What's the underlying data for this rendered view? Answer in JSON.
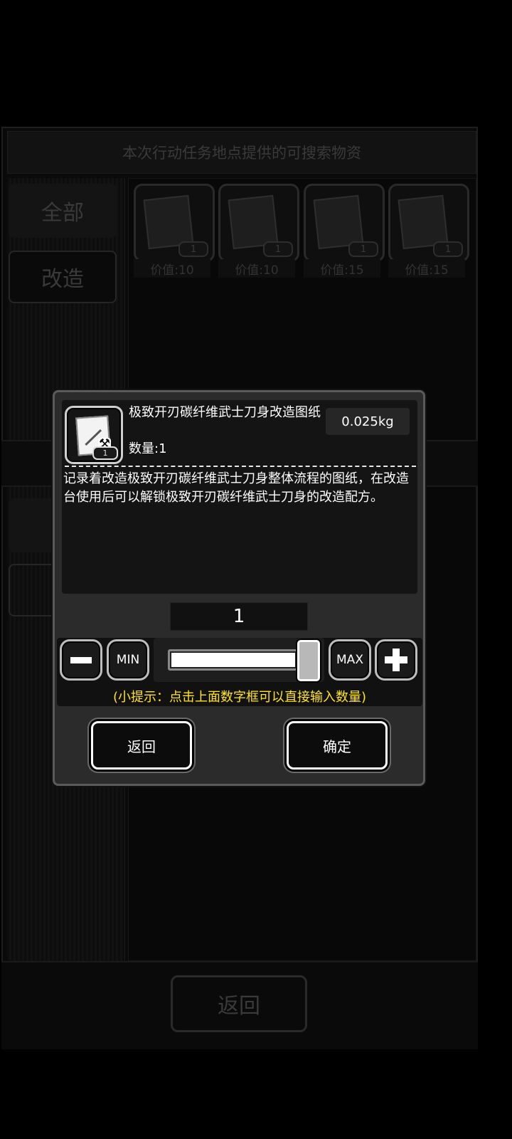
{
  "background": {
    "title": "本次行动任务地点提供的可搜索物资",
    "tabs": [
      {
        "label": "全部"
      },
      {
        "label": "改造"
      }
    ],
    "items": [
      {
        "value_label": "价值:10",
        "count": "1"
      },
      {
        "value_label": "价值:10",
        "count": "1"
      },
      {
        "value_label": "价值:15",
        "count": "1"
      },
      {
        "value_label": "价值:15",
        "count": "1"
      }
    ],
    "back_label": "返回"
  },
  "dialog": {
    "item_name": "极致开刃碳纤维武士刀身改造图纸",
    "item_quantity": "数量:1",
    "item_weight": "0.025kg",
    "item_badge": "1",
    "item_description": "记录着改造极致开刃碳纤维武士刀身整体流程的图纸，在改造台使用后可以解锁极致开刃碳纤维武士刀身的改造配方。",
    "quantity_value": "1",
    "slider_fraction": 1.0,
    "min_label": "MIN",
    "max_label": "MAX",
    "hint": "(小提示：点击上面数字框可以直接输入数量)",
    "back_label": "返回",
    "confirm_label": "确定",
    "colors": {
      "hint": "#ffe419",
      "panel": "#2b2b2b"
    }
  },
  "icons": {
    "item": "blueprint-icon",
    "minus": "minus-icon",
    "plus": "plus-icon"
  }
}
